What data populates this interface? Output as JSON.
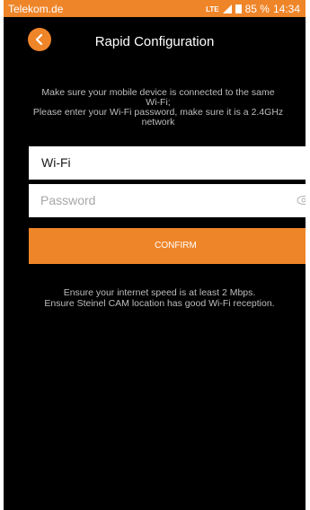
{
  "status_bar": {
    "carrier": "Telekom.de",
    "network": "LTE",
    "battery": "85 %",
    "time": "14:34",
    "icons": [
      "lte-icon",
      "signal-icon",
      "battery-icon"
    ]
  },
  "header": {
    "back_icon": "chevron-left-icon",
    "title": "Rapid Configuration"
  },
  "instructions": {
    "line1": "Make sure your mobile device is connected to the same",
    "line2": "Wi-Fi;",
    "line3": "Please enter your Wi-Fi password, make sure it is a 2.4GHz",
    "line4": "network"
  },
  "form": {
    "wifi_value": "Wi-Fi",
    "password_placeholder": "Password",
    "password_icon": "eye-icon",
    "confirm_label": "CONFIRM"
  },
  "notes": {
    "line1": "Ensure your internet speed is at least 2 Mbps.",
    "line2": "Ensure Steinel CAM location has good Wi-Fi reception."
  },
  "colors": {
    "accent": "#ef8529",
    "background": "#000000",
    "text_muted": "#bdbdbd",
    "field_bg": "#ffffff"
  }
}
